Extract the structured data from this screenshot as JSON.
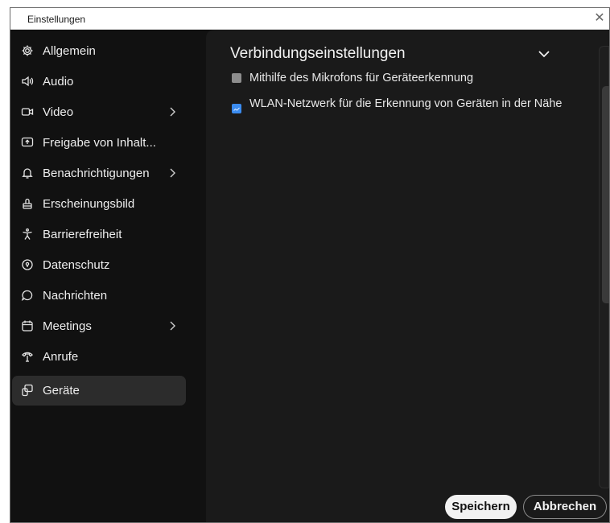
{
  "window": {
    "title": "Einstellungen"
  },
  "sidebar": {
    "items": [
      {
        "label": "Allgemein",
        "icon": "gear-icon",
        "chevron": false,
        "active": false
      },
      {
        "label": "Audio",
        "icon": "speaker-icon",
        "chevron": false,
        "active": false
      },
      {
        "label": "Video",
        "icon": "camera-icon",
        "chevron": true,
        "active": false
      },
      {
        "label": "Freigabe von Inhalt...",
        "icon": "share-screen-icon",
        "chevron": false,
        "active": false
      },
      {
        "label": "Benachrichtigungen",
        "icon": "bell-icon",
        "chevron": true,
        "active": false
      },
      {
        "label": "Erscheinungsbild",
        "icon": "brush-icon",
        "chevron": false,
        "active": false
      },
      {
        "label": "Barrierefreiheit",
        "icon": "accessibility-icon",
        "chevron": false,
        "active": false
      },
      {
        "label": "Datenschutz",
        "icon": "privacy-icon",
        "chevron": false,
        "active": false
      },
      {
        "label": "Nachrichten",
        "icon": "chat-bubble-icon",
        "chevron": false,
        "active": false
      },
      {
        "label": "Meetings",
        "icon": "calendar-icon",
        "chevron": true,
        "active": false
      },
      {
        "label": "Anrufe",
        "icon": "phone-icon",
        "chevron": false,
        "active": false
      },
      {
        "label": "Geräte",
        "icon": "devices-icon",
        "chevron": false,
        "active": true
      }
    ]
  },
  "main": {
    "section_title": "Verbindungseinstellungen",
    "options": [
      {
        "label": "Mithilfe des Mikrofons für Geräteerkennung",
        "checked": false
      },
      {
        "label": "WLAN-Netzwerk für die Erkennung von Geräten in der Nähe",
        "checked": true
      }
    ]
  },
  "footer": {
    "save_label": "Speichern",
    "cancel_label": "Abbrechen"
  },
  "colors": {
    "background": "#111111",
    "panel": "#1a1a1a",
    "active_item": "#2c2c2c",
    "checkbox_checked": "#3b8cf0"
  }
}
